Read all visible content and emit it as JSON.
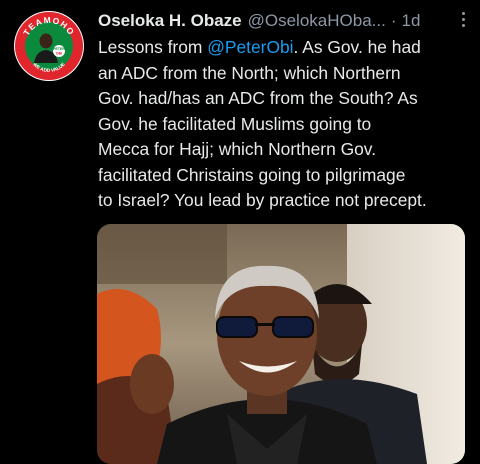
{
  "tweet": {
    "author_name": "Oseloka H. Obaze",
    "handle": "@OselokaHOba...",
    "separator": "·",
    "time": "1d",
    "text_lines": [
      {
        "before": "Lessons from ",
        "mention": "@PeterObi",
        "after": ". As Gov. he had"
      },
      {
        "text": "an ADC from the North; which Northern"
      },
      {
        "text": "Gov. had/has an ADC from the  South?  As"
      },
      {
        "text": "Gov. he facilitated Muslims going to"
      },
      {
        "text": "Mecca for Hajj; which Northern Gov."
      },
      {
        "text": "facilitated Christains going to pilgrimage"
      },
      {
        "text": "to Israel? You lead by practice not precept."
      }
    ]
  },
  "avatar": {
    "badge_text": "TEAMOHO",
    "slogan": "WE ADD VALUE",
    "button_line1": "PETER",
    "button_line2": "OBI"
  },
  "icons": {
    "more": "more-vertical-icon"
  },
  "colors": {
    "background": "#000000",
    "text": "#e7e9ea",
    "secondary": "#8b98a5",
    "link": "#1d9bf0",
    "badge_red": "#e0252c",
    "badge_green": "#0b8a3e"
  }
}
